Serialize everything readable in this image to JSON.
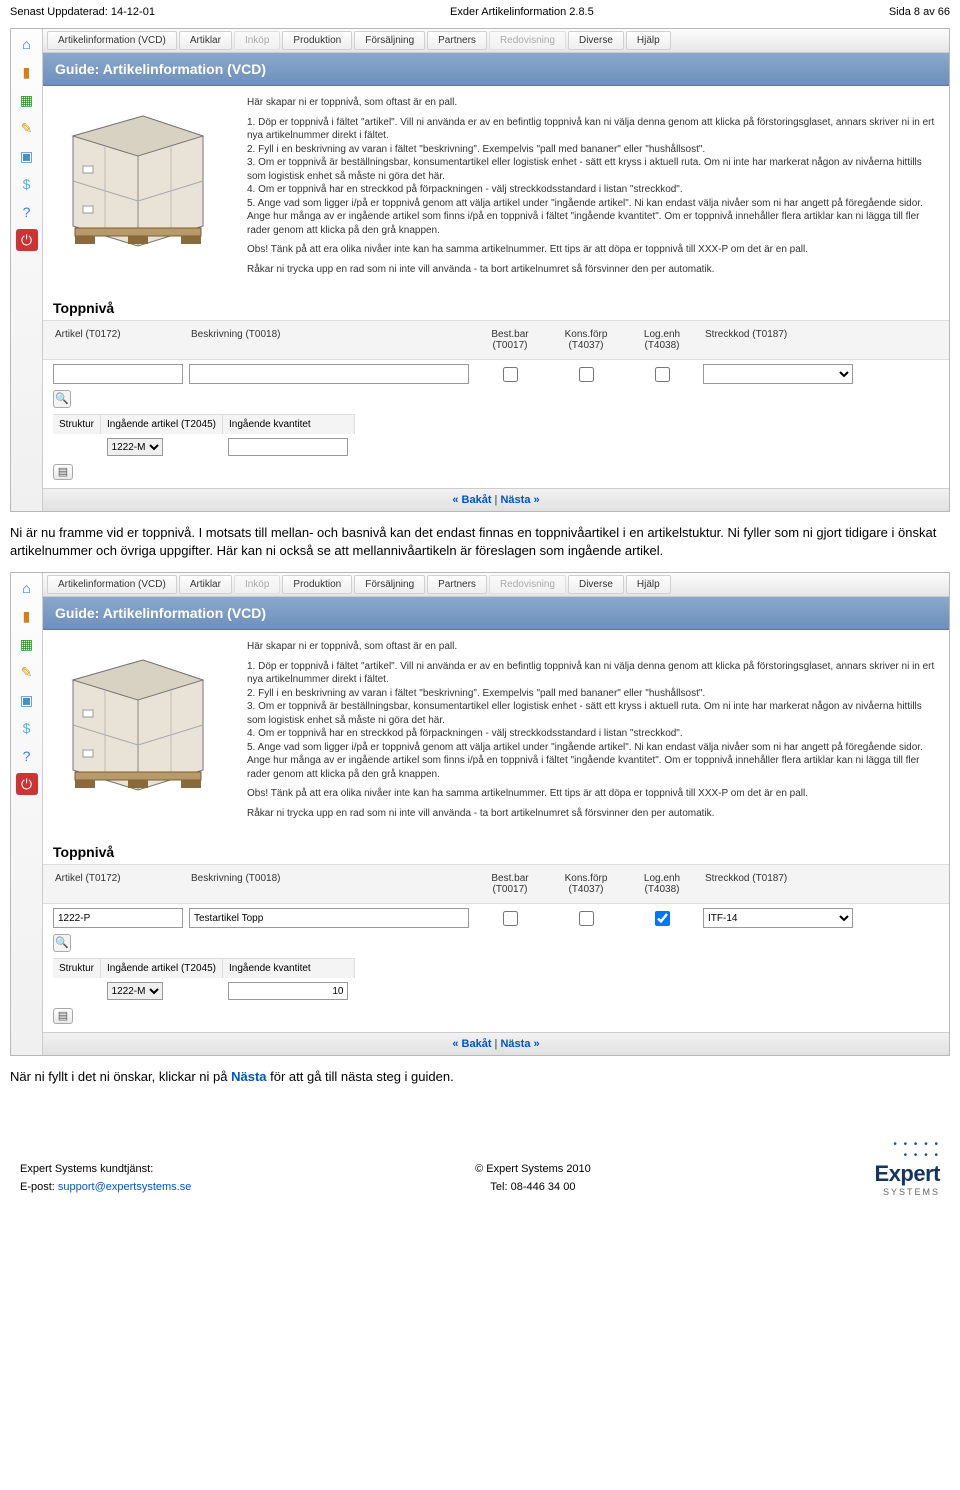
{
  "meta": {
    "updated": "Senast Uppdaterad: 14-12-01",
    "title": "Exder Artikelinformation 2.8.5",
    "page": "Sida 8 av 66"
  },
  "menu": {
    "items": [
      "Artikelinformation (VCD)",
      "Artiklar",
      "Inköp",
      "Produktion",
      "Försäljning",
      "Partners",
      "Redovisning",
      "Diverse",
      "Hjälp"
    ],
    "disabled_indices": [
      2,
      6
    ]
  },
  "sidebar_icons": [
    "home",
    "chart",
    "spreadsheet",
    "note",
    "truck",
    "dollar",
    "help",
    "power"
  ],
  "guide": {
    "title": "Guide: Artikelinformation (VCD)",
    "intro": "Här skapar ni er toppnivå, som oftast är en pall.",
    "steps": "1. Döp er toppnivå i fältet \"artikel\". Vill ni använda er av en befintlig toppnivå kan ni välja denna genom att klicka på förstoringsglaset, annars skriver ni in ert nya artikelnummer direkt i fältet.\n2. Fyll i en beskrivning av varan i fältet \"beskrivning\". Exempelvis \"pall med bananer\" eller \"hushållsost\".\n3. Om er toppnivå är beställningsbar, konsumentartikel eller logistisk enhet - sätt ett kryss i aktuell ruta. Om ni inte har markerat någon av nivåerna hittills som logistisk enhet så måste ni göra det här.\n4. Om er toppnivå har en streckkod på förpackningen - välj streckkodsstandard i listan \"streckkod\".\n5. Ange vad som ligger i/på er toppnivå genom att välja artikel under \"ingående artikel\". Ni kan endast välja nivåer som ni har angett på föregående sidor. Ange hur många av er ingående artikel som finns i/på en toppnivå i fältet \"ingående kvantitet\". Om er toppnivå innehåller flera artiklar kan ni lägga till fler rader genom att klicka på den grå knappen.",
    "obs": "Obs! Tänk på att era olika nivåer inte kan ha samma artikelnummer. Ett tips är att döpa er toppnivå till XXX-P om det är en pall.",
    "tail": "Råkar ni trycka upp en rad som ni inte vill använda - ta bort artikelnumret så försvinner den per automatik."
  },
  "section_title": "Toppnivå",
  "columns": {
    "artikel": "Artikel (T0172)",
    "beskrivning": "Beskrivning (T0018)",
    "best": "Best.bar (T0017)",
    "kons": "Kons.förp (T4037)",
    "log": "Log.enh (T4038)",
    "streck": "Streckkod (T0187)"
  },
  "row2_headers": {
    "struktur": "Struktur",
    "ingart": "Ingående artikel (T2045)",
    "ingkv": "Ingående kvantitet"
  },
  "form_a": {
    "artikel": "",
    "beskrivning": "",
    "best": false,
    "kons": false,
    "log": false,
    "streck": "",
    "ingart": "1222-M",
    "ingkv": ""
  },
  "form_b": {
    "artikel": "1222-P",
    "beskrivning": "Testartikel Topp",
    "best": false,
    "kons": false,
    "log": true,
    "streck": "ITF-14",
    "ingart": "1222-M",
    "ingkv": "10"
  },
  "nav": {
    "back": "« Bakåt",
    "next": "Nästa »",
    "sep": " | "
  },
  "para1": "Ni är nu framme vid er toppnivå. I motsats till mellan- och basnivå kan det endast finnas en toppnivåartikel i en artikelstuktur. Ni fyller som ni gjort tidigare i önskat artikelnummer och övriga uppgifter. Här kan ni också se att mellannivåartikeln är föreslagen som ingående artikel.",
  "para2_a": "När ni fyllt i det ni önskar, klickar ni på ",
  "para2_link": "Nästa",
  "para2_b": " för att gå till nästa steg i guiden.",
  "footer": {
    "l1": "Expert Systems kundtjänst:",
    "l2a": "E-post: ",
    "l2b": "support@expertsystems.se",
    "c1": "© Expert Systems 2010",
    "c2": "Tel: 08-446 34 00",
    "brand": "Expert",
    "sub": "SYSTEMS"
  }
}
